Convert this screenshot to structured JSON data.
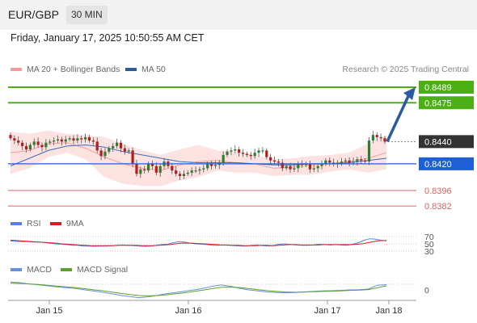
{
  "header": {
    "symbol": "EUR/GBP",
    "timeframe": "30 MIN"
  },
  "datetime": "Friday, January 17, 2025 10:50:55 AM CET",
  "copyright": "Research © 2025 Trading Central",
  "colors": {
    "green": "#4caf13",
    "blue": "#1e5fd8",
    "red": "#e06060",
    "dark": "#333333",
    "bb_fill": "#fde2e2",
    "ma50": "#3a6db5",
    "arrow": "#2c5aa0",
    "rsi": "#5b7fde",
    "rsi_ma": "#d12020",
    "macd": "#6a8fd8",
    "signal": "#5aa02c"
  },
  "chart_data": [
    {
      "type": "candlestick",
      "legend": [
        {
          "label": "MA 20 + Bollinger Bands",
          "color": "#f08080"
        },
        {
          "label": "MA 50",
          "color": "#2e5c9a"
        }
      ],
      "x_ticks": [
        "Jan 15",
        "Jan 16",
        "Jan 17",
        "Jan 18"
      ],
      "ylim": [
        0.8377,
        0.8497
      ],
      "levels": [
        {
          "value": 0.8489,
          "label": "0.8489",
          "kind": "resistance",
          "color": "#4caf13"
        },
        {
          "value": 0.8475,
          "label": "0.8475",
          "kind": "resistance",
          "color": "#4caf13"
        },
        {
          "value": 0.844,
          "label": "0.8440",
          "kind": "current",
          "color": "#333333"
        },
        {
          "value": 0.842,
          "label": "0.8420",
          "kind": "pivot",
          "color": "#1e5fd8"
        },
        {
          "value": 0.8396,
          "label": "0.8396",
          "kind": "support",
          "color": "#e06060"
        },
        {
          "value": 0.8382,
          "label": "0.8382",
          "kind": "support",
          "color": "#e06060"
        }
      ],
      "closes": [
        0.8443,
        0.8441,
        0.8439,
        0.8436,
        0.8433,
        0.8437,
        0.844,
        0.8437,
        0.8435,
        0.8439,
        0.844,
        0.8441,
        0.8442,
        0.844,
        0.8442,
        0.8443,
        0.8441,
        0.8443,
        0.8442,
        0.8444,
        0.8441,
        0.844,
        0.8432,
        0.8427,
        0.8431,
        0.8434,
        0.8436,
        0.8439,
        0.8434,
        0.8431,
        0.8432,
        0.842,
        0.8411,
        0.8415,
        0.8414,
        0.842,
        0.8418,
        0.8412,
        0.8418,
        0.8422,
        0.8418,
        0.8414,
        0.8411,
        0.8409,
        0.8411,
        0.8412,
        0.8414,
        0.8414,
        0.8415,
        0.8416,
        0.842,
        0.8418,
        0.8419,
        0.8421,
        0.8428,
        0.8431,
        0.8432,
        0.8433,
        0.843,
        0.8429,
        0.8428,
        0.8427,
        0.843,
        0.8432,
        0.8432,
        0.8426,
        0.8423,
        0.8422,
        0.8421,
        0.8416,
        0.8418,
        0.8415,
        0.8416,
        0.842,
        0.8419,
        0.842,
        0.8415,
        0.8416,
        0.8418,
        0.842,
        0.8423,
        0.8421,
        0.842,
        0.8421,
        0.8422,
        0.8423,
        0.8421,
        0.8422,
        0.8424,
        0.8423,
        0.8422,
        0.8441,
        0.8446,
        0.8444,
        0.8443,
        0.844
      ],
      "bollinger": {
        "upper": [
          0.8449,
          0.8447,
          0.845,
          0.8447,
          0.8446,
          0.8444,
          0.8438,
          0.8432,
          0.8428,
          0.8433,
          0.8437,
          0.8432,
          0.8431,
          0.8428,
          0.8424,
          0.8425,
          0.8427,
          0.8428,
          0.843,
          0.8438,
          0.8446
        ],
        "lower": [
          0.8411,
          0.8416,
          0.8426,
          0.843,
          0.8424,
          0.8408,
          0.8402,
          0.84,
          0.84,
          0.8405,
          0.8408,
          0.8414,
          0.8412,
          0.8412,
          0.8409,
          0.841,
          0.841,
          0.8413,
          0.8415,
          0.8412,
          0.8415
        ]
      },
      "ma20": [
        0.843,
        0.8432,
        0.8438,
        0.8439,
        0.8434,
        0.8426,
        0.842,
        0.8416,
        0.8414,
        0.8419,
        0.8422,
        0.8423,
        0.8421,
        0.842,
        0.8416,
        0.8417,
        0.8419,
        0.842,
        0.8422,
        0.8425,
        0.843
      ],
      "ma50": [
        0.8418,
        0.8425,
        0.8432,
        0.8436,
        0.8437,
        0.8435,
        0.8431,
        0.8428,
        0.8425,
        0.8422,
        0.8421,
        0.8421,
        0.8421,
        0.842,
        0.8419,
        0.8419,
        0.842,
        0.842,
        0.8421,
        0.8423,
        0.8425
      ]
    },
    {
      "type": "line",
      "series": [
        {
          "name": "RSI",
          "color": "#5b7fde"
        },
        {
          "name": "9MA",
          "color": "#d12020"
        }
      ],
      "y_ticks": [
        "70",
        "50",
        "30"
      ],
      "rsi": [
        58,
        57,
        56,
        56,
        55,
        55,
        54,
        52,
        50,
        49,
        48,
        46,
        46,
        44,
        44,
        43,
        44,
        44,
        45,
        46,
        47,
        46,
        45,
        44,
        43,
        44,
        46,
        48,
        49,
        53,
        56,
        55,
        52,
        50,
        49,
        48,
        46,
        46,
        47,
        46,
        45,
        44,
        44,
        46,
        47,
        45,
        44,
        46,
        49,
        50,
        48,
        47,
        46,
        46,
        47,
        49,
        48,
        47,
        48,
        47,
        46,
        49,
        53,
        60,
        64,
        63,
        60,
        58
      ],
      "rsi_ma": [
        60,
        59,
        58,
        57,
        56,
        55,
        54,
        53,
        52,
        50,
        49,
        48,
        47,
        46,
        45,
        45,
        45,
        45,
        45,
        46,
        46,
        46,
        46,
        45,
        45,
        45,
        46,
        47,
        48,
        50,
        52,
        52,
        52,
        51,
        50,
        49,
        48,
        47,
        47,
        46,
        46,
        45,
        45,
        45,
        46,
        46,
        45,
        46,
        47,
        48,
        48,
        47,
        47,
        47,
        47,
        48,
        48,
        48,
        48,
        48,
        48,
        49,
        51,
        54,
        57,
        59,
        59
      ]
    },
    {
      "type": "line",
      "series": [
        {
          "name": "MACD",
          "color": "#6a8fd8"
        },
        {
          "name": "MACD Signal",
          "color": "#5aa02c"
        }
      ],
      "y_ticks": [
        "0"
      ],
      "macd": [
        3.0,
        2.8,
        2.3,
        2.0,
        1.6,
        1.2,
        0.9,
        0.6,
        0.1,
        -0.4,
        -0.9,
        -1.5,
        -2.1,
        -2.6,
        -3.0,
        -2.7,
        -2.1,
        -1.5,
        -1.0,
        -0.5,
        0.0,
        0.6,
        1.4,
        1.9,
        1.4,
        0.6,
        0.0,
        -0.4,
        -0.8,
        -1.0,
        -1.1,
        -1.0,
        -0.8,
        -0.6,
        -0.4,
        -0.3,
        -0.2,
        0.0,
        0.1,
        0.3,
        1.8,
        2.0
      ],
      "signal": [
        2.6,
        2.5,
        2.3,
        2.1,
        1.8,
        1.5,
        1.2,
        0.9,
        0.5,
        0.1,
        -0.3,
        -0.8,
        -1.3,
        -1.8,
        -2.2,
        -2.3,
        -2.2,
        -1.9,
        -1.5,
        -1.1,
        -0.6,
        -0.1,
        0.5,
        1.0,
        1.1,
        0.9,
        0.5,
        0.1,
        -0.3,
        -0.6,
        -0.8,
        -0.9,
        -0.8,
        -0.7,
        -0.6,
        -0.5,
        -0.4,
        -0.2,
        -0.1,
        0.1,
        0.8,
        1.6
      ]
    }
  ]
}
